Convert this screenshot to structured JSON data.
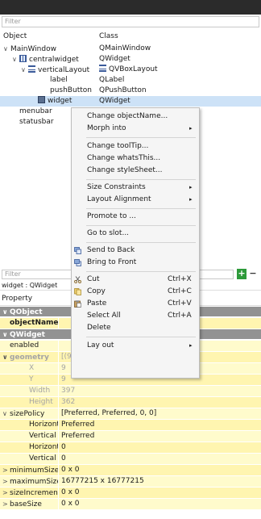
{
  "object_inspector": {
    "filter_placeholder": "Filter",
    "header_object": "Object",
    "header_class": "Class",
    "rows": [
      {
        "object": "MainWindow",
        "class": "QMainWindow"
      },
      {
        "object": "centralwidget",
        "class": "QWidget"
      },
      {
        "object": "verticalLayout",
        "class": "QVBoxLayout"
      },
      {
        "object": "label",
        "class": "QLabel"
      },
      {
        "object": "pushButton",
        "class": "QPushButton"
      },
      {
        "object": "widget",
        "class": "QWidget"
      },
      {
        "object": "menubar",
        "class": ""
      },
      {
        "object": "statusbar",
        "class": ""
      }
    ]
  },
  "context_menu": {
    "change_object_name": "Change objectName...",
    "morph_into": "Morph into",
    "change_tooltip": "Change toolTip...",
    "change_whats_this": "Change whatsThis...",
    "change_style_sheet": "Change styleSheet...",
    "size_constraints": "Size Constraints",
    "layout_alignment": "Layout Alignment",
    "promote_to": "Promote to ...",
    "go_to_slot": "Go to slot...",
    "send_to_back": "Send to Back",
    "bring_to_front": "Bring to Front",
    "cut": "Cut",
    "cut_shortcut": "Ctrl+X",
    "copy": "Copy",
    "copy_shortcut": "Ctrl+C",
    "paste": "Paste",
    "paste_shortcut": "Ctrl+V",
    "select_all": "Select All",
    "select_all_shortcut": "Ctrl+A",
    "delete": "Delete",
    "lay_out": "Lay out"
  },
  "property_editor": {
    "filter_placeholder": "Filter",
    "title": "widget : QWidget",
    "header_property": "Property",
    "rows": [
      {
        "name": "QObject",
        "value": ""
      },
      {
        "name": "objectName",
        "value": ""
      },
      {
        "name": "QWidget",
        "value": ""
      },
      {
        "name": "enabled",
        "value": ""
      },
      {
        "name": "geometry",
        "value": "[(9, 9), 397 x 362]"
      },
      {
        "name": "X",
        "value": "9"
      },
      {
        "name": "Y",
        "value": "9"
      },
      {
        "name": "Width",
        "value": "397"
      },
      {
        "name": "Height",
        "value": "362"
      },
      {
        "name": "sizePolicy",
        "value": "[Preferred, Preferred, 0, 0]"
      },
      {
        "name": "Horizontal Pol...",
        "value": "Preferred"
      },
      {
        "name": "Vertical Policy",
        "value": "Preferred"
      },
      {
        "name": "Horizontal Str...",
        "value": "0"
      },
      {
        "name": "Vertical Stretch",
        "value": "0"
      },
      {
        "name": "minimumSize",
        "value": "0 x 0"
      },
      {
        "name": "maximumSize",
        "value": "16777215 x 16777215"
      },
      {
        "name": "sizeIncrement",
        "value": "0 x 0"
      },
      {
        "name": "baseSize",
        "value": "0 x 0"
      }
    ]
  },
  "glyphs": {
    "expanded": "∨",
    "collapsed": ">",
    "submenu": "▸",
    "plus": "+",
    "minus": "−"
  },
  "colors": {
    "selection": "#cde2f7",
    "category": "#929292",
    "highlight_yellow": "#fffbcc",
    "add_button": "#2d9a3a"
  }
}
